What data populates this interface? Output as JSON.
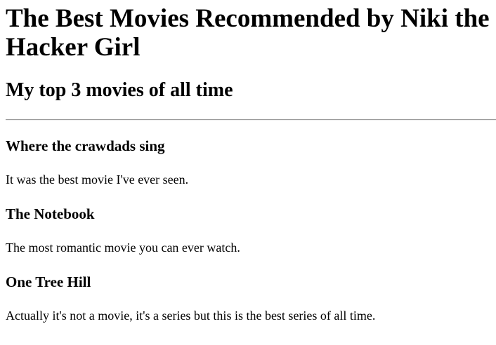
{
  "page": {
    "title": "The Best Movies Recommended by Niki the Hacker Girl",
    "subtitle": "My top 3 movies of all time"
  },
  "movies": [
    {
      "title": "Where the crawdads sing",
      "description": "It was the best movie I've ever seen."
    },
    {
      "title": "The Notebook",
      "description": "The most romantic movie you can ever watch."
    },
    {
      "title": "One Tree Hill",
      "description": "Actually it's not a movie, it's a series but this is the best series of all time."
    }
  ]
}
